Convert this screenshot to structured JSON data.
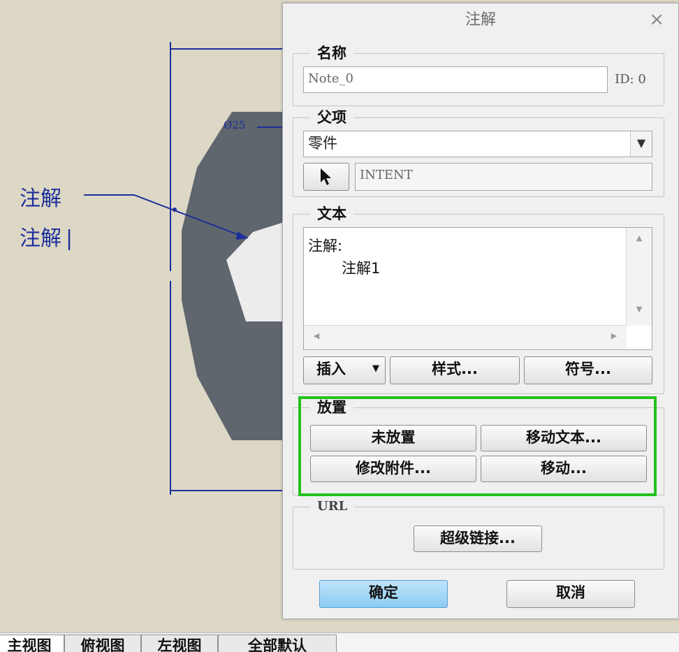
{
  "drawing": {
    "note_line1": "注解",
    "note_line2": "注解",
    "dim_label": "Ø25"
  },
  "dialog": {
    "title": "注解",
    "close_glyph": "×",
    "name_group": {
      "legend": "名称",
      "name_value": "Note_0",
      "id_label": "ID: 0"
    },
    "parent_group": {
      "legend": "父项",
      "selected": "零件",
      "reference_value": "INTENT"
    },
    "text_group": {
      "legend": "文本",
      "line1": "注解:",
      "line2": "注解1",
      "insert_label": "插入",
      "style_label": "样式...",
      "symbol_label": "符号..."
    },
    "placement_group": {
      "legend": "放置",
      "not_placed_label": "未放置",
      "move_text_label": "移动文本...",
      "modify_attach_label": "修改附件...",
      "move_label": "移动..."
    },
    "url_group": {
      "legend": "URL",
      "hyperlink_label": "超级链接..."
    },
    "ok_label": "确定",
    "cancel_label": "取消"
  },
  "tabs": [
    "主视图",
    "俯视图",
    "左视图",
    "全部默认"
  ],
  "colors": {
    "background": "#ddd8c6",
    "part_fill": "#5f666d",
    "annotation_blue": "#1d2e9a",
    "highlight": "#22c31d",
    "ok_button": "#a6d8f7"
  }
}
